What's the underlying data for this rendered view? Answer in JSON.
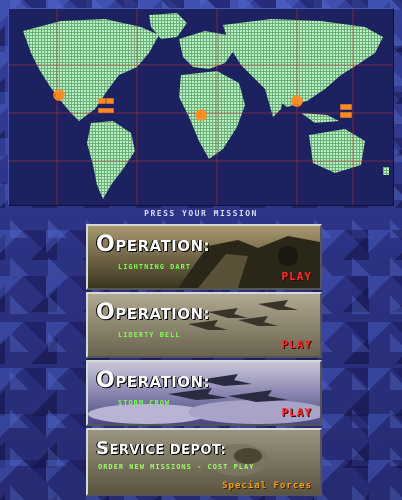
{
  "map": {
    "prompt": "Press Your Mission",
    "colors": {
      "land": "#b8f0c0",
      "grid": "#c03030",
      "ocean": "#1c2160",
      "marker": "#ff8a20"
    },
    "markers": [
      {
        "name": "north-america-marker-icon"
      },
      {
        "name": "europe-marker-icon"
      },
      {
        "name": "middle-east-marker-icon"
      },
      {
        "name": "asia-marker-icon"
      }
    ]
  },
  "missions": [
    {
      "prefix": "O",
      "title": "peration:",
      "subtitle": "Lightning Dart",
      "play_label": "Play"
    },
    {
      "prefix": "O",
      "title": "peration:",
      "subtitle": "Liberty Bell",
      "play_label": "Play"
    },
    {
      "prefix": "O",
      "title": "peration:",
      "subtitle": "Storm Crow",
      "play_label": "Play"
    }
  ],
  "depot": {
    "prefix": "S",
    "title": "ervice Depot:",
    "subtitle": "Order New Missions  -  Cost Play",
    "credits_label": "Special Forces"
  }
}
